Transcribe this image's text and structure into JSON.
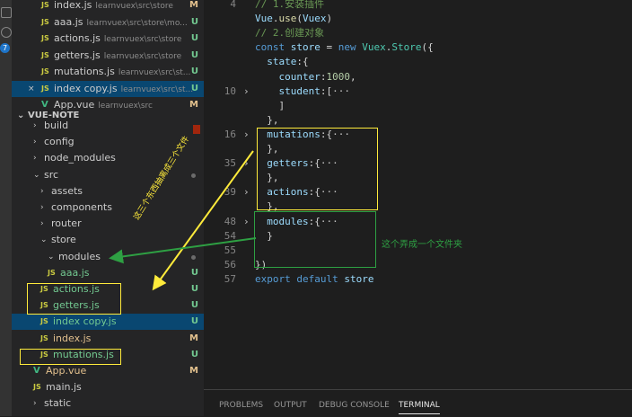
{
  "activity": {
    "badge": "7"
  },
  "explorer": {
    "open_editors": [
      {
        "icon": "JS",
        "name": "index.js",
        "path": "learnvuex\\src\\store",
        "status": "M"
      },
      {
        "icon": "JS",
        "name": "aaa.js",
        "path": "learnvuex\\src\\store\\mo...",
        "status": "U"
      },
      {
        "icon": "JS",
        "name": "actions.js",
        "path": "learnvuex\\src\\store",
        "status": "U"
      },
      {
        "icon": "JS",
        "name": "getters.js",
        "path": "learnvuex\\src\\store",
        "status": "U"
      },
      {
        "icon": "JS",
        "name": "mutations.js",
        "path": "learnvuex\\src\\st...",
        "status": "U"
      },
      {
        "icon": "JS",
        "name": "index copy.js",
        "path": "learnvuex\\src\\st...",
        "status": "U",
        "close": "×"
      },
      {
        "icon": "V",
        "name": "App.vue",
        "path": "learnvuex\\src",
        "status": "M"
      }
    ],
    "section_title": "VUE-NOTE",
    "tree": [
      {
        "name": "build",
        "chev": "›"
      },
      {
        "name": "config",
        "chev": "›"
      },
      {
        "name": "node_modules",
        "chev": "›"
      },
      {
        "name": "src",
        "chev": "⌄"
      },
      {
        "name": "assets",
        "chev": "›"
      },
      {
        "name": "components",
        "chev": "›"
      },
      {
        "name": "router",
        "chev": "›"
      },
      {
        "name": "store",
        "chev": "⌄"
      },
      {
        "name": "modules",
        "chev": "⌄"
      },
      {
        "icon": "JS",
        "name": "aaa.js",
        "status": "U"
      },
      {
        "icon": "JS",
        "name": "actions.js",
        "status": "U"
      },
      {
        "icon": "JS",
        "name": "getters.js",
        "status": "U"
      },
      {
        "icon": "JS",
        "name": "index copy.js",
        "status": "U"
      },
      {
        "icon": "JS",
        "name": "index.js",
        "status": "M"
      },
      {
        "icon": "JS",
        "name": "mutations.js",
        "status": "U"
      },
      {
        "icon": "V",
        "name": "App.vue",
        "status": "M"
      },
      {
        "icon": "JS",
        "name": "main.js",
        "status": ""
      },
      {
        "name": "static",
        "chev": "›"
      }
    ]
  },
  "editor": {
    "lines": [
      {
        "n": "4",
        "parts": [
          [
            "cm",
            "// 1.安装插件"
          ]
        ]
      },
      {
        "n": "",
        "parts": [
          [
            "var",
            "Vue"
          ],
          [
            "",
            "."
          ],
          [
            "fn",
            "use"
          ],
          [
            "",
            "("
          ],
          [
            "var",
            "Vuex"
          ],
          [
            "",
            ")"
          ]
        ]
      },
      {
        "n": "",
        "parts": [
          [
            "cm",
            "// 2.创建对象"
          ]
        ]
      },
      {
        "n": "",
        "parts": [
          [
            "kw",
            "const"
          ],
          [
            "",
            " "
          ],
          [
            "var",
            "store"
          ],
          [
            "",
            " = "
          ],
          [
            "kw",
            "new"
          ],
          [
            "",
            " "
          ],
          [
            "cls",
            "Vuex"
          ],
          [
            "",
            "."
          ],
          [
            "cls",
            "Store"
          ],
          [
            "",
            "({"
          ]
        ]
      },
      {
        "n": "",
        "parts": [
          [
            "",
            "  "
          ],
          [
            "var",
            "state"
          ],
          [
            "",
            ":{"
          ]
        ]
      },
      {
        "n": "",
        "parts": [
          [
            "",
            "    "
          ],
          [
            "var",
            "counter"
          ],
          [
            "",
            ":"
          ],
          [
            "num",
            "1000"
          ],
          [
            "",
            ","
          ]
        ]
      },
      {
        "n": "10",
        "fold": "›",
        "parts": [
          [
            "",
            "    "
          ],
          [
            "var",
            "student"
          ],
          [
            "",
            ":["
          ],
          [
            "ell",
            "···"
          ]
        ]
      },
      {
        "n": "",
        "parts": [
          [
            "",
            "    ]"
          ]
        ]
      },
      {
        "n": "",
        "parts": [
          [
            "",
            "  },"
          ]
        ]
      },
      {
        "n": "16",
        "fold": "›",
        "parts": [
          [
            "",
            "  "
          ],
          [
            "var",
            "mutations"
          ],
          [
            "",
            ":{"
          ],
          [
            "ell",
            "···"
          ]
        ]
      },
      {
        "n": "",
        "parts": [
          [
            "",
            "  },"
          ]
        ]
      },
      {
        "n": "35",
        "fold": "›",
        "parts": [
          [
            "",
            "  "
          ],
          [
            "var",
            "getters"
          ],
          [
            "",
            ":{"
          ],
          [
            "ell",
            "···"
          ]
        ]
      },
      {
        "n": "",
        "parts": [
          [
            "",
            "  },"
          ]
        ]
      },
      {
        "n": "39",
        "fold": "›",
        "parts": [
          [
            "",
            "  "
          ],
          [
            "var",
            "actions"
          ],
          [
            "",
            ":{"
          ],
          [
            "ell",
            "···"
          ]
        ]
      },
      {
        "n": "",
        "parts": [
          [
            "",
            "  },"
          ]
        ]
      },
      {
        "n": "48",
        "fold": "›",
        "parts": [
          [
            "",
            "  "
          ],
          [
            "var",
            "modules"
          ],
          [
            "",
            ":{"
          ],
          [
            "ell",
            "···"
          ]
        ]
      },
      {
        "n": "54",
        "parts": [
          [
            "",
            "  }"
          ]
        ]
      },
      {
        "n": "55",
        "parts": []
      },
      {
        "n": "56",
        "parts": [
          [
            "",
            "})"
          ]
        ]
      },
      {
        "n": "57",
        "parts": [
          [
            "kw",
            "export"
          ],
          [
            "",
            " "
          ],
          [
            "kw",
            "default"
          ],
          [
            "",
            " "
          ],
          [
            "var",
            "store"
          ]
        ]
      }
    ]
  },
  "annotations": {
    "vertical_note": "这三个东西抽离成三个文件",
    "folder_note": "这个弄成一个文件夹"
  },
  "panel": {
    "tabs": [
      "PROBLEMS",
      "OUTPUT",
      "DEBUG CONSOLE",
      "TERMINAL"
    ]
  },
  "colors": {
    "yellow": "#ffeb3b",
    "green": "#2ea043"
  }
}
